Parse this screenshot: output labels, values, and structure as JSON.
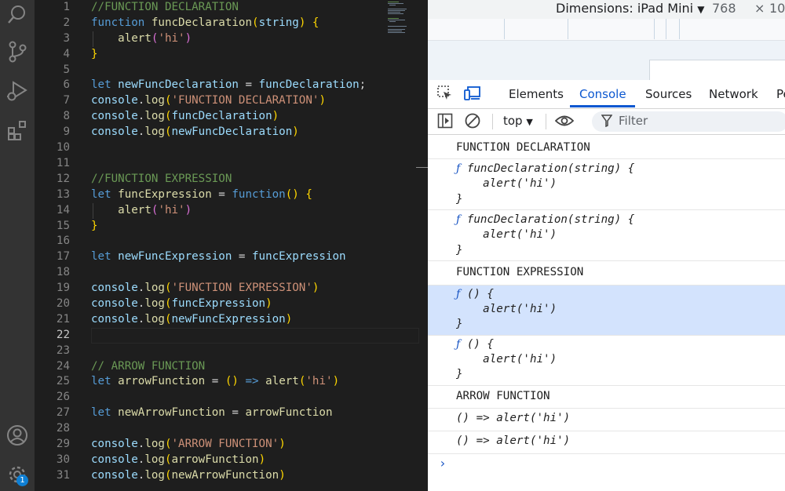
{
  "editor": {
    "active_line": "22",
    "line_numbers": [
      "1",
      "2",
      "3",
      "4",
      "5",
      "6",
      "7",
      "8",
      "9",
      "10",
      "11",
      "12",
      "13",
      "14",
      "15",
      "16",
      "17",
      "18",
      "19",
      "20",
      "21",
      "22",
      "23",
      "24",
      "25",
      "26",
      "27",
      "28",
      "29",
      "30",
      "31"
    ],
    "code": {
      "l1": "//FUNCTION DECLARATION",
      "l2_kw": "function",
      "l2_fn": "funcDeclaration",
      "l2_param": "string",
      "l3_fn": "alert",
      "l3_str": "'hi'",
      "l6_kw": "let",
      "l6_var": "newFuncDeclaration",
      "l6_rhs": "funcDeclaration",
      "l7_obj": "console",
      "l7_fn": "log",
      "l7_str": "'FUNCTION DECLARATION'",
      "l8_obj": "console",
      "l8_fn": "log",
      "l8_arg": "funcDeclaration",
      "l9_obj": "console",
      "l9_fn": "log",
      "l9_arg": "newFuncDeclaration",
      "l12": "//FUNCTION EXPRESSION",
      "l13_kw": "let",
      "l13_var": "funcExpression",
      "l13_kw2": "function",
      "l14_fn": "alert",
      "l14_str": "'hi'",
      "l17_kw": "let",
      "l17_var": "newFuncExpression",
      "l17_rhs": "funcExpression",
      "l19_obj": "console",
      "l19_fn": "log",
      "l19_str": "'FUNCTION EXPRESSION'",
      "l20_obj": "console",
      "l20_fn": "log",
      "l20_arg": "funcExpression",
      "l21_obj": "console",
      "l21_fn": "log",
      "l21_arg": "newFuncExpression",
      "l24": "// ARROW FUNCTION",
      "l25_kw": "let",
      "l25_var": "arrowFunction",
      "l25_arrow": "=>",
      "l25_fn": "alert",
      "l25_str": "'hi'",
      "l27_kw": "let",
      "l27_var": "newArrowFunction",
      "l27_rhs": "arrowFunction",
      "l29_obj": "console",
      "l29_fn": "log",
      "l29_str": "'ARROW FUNCTION'",
      "l30_obj": "console",
      "l30_fn": "log",
      "l30_arg": "arrowFunction",
      "l31_obj": "console",
      "l31_fn": "log",
      "l31_arg": "newArrowFunction"
    }
  },
  "activity_bar": {
    "icons": [
      "search-icon",
      "source-control-icon",
      "run-debug-icon",
      "extensions-icon",
      "account-icon",
      "settings-gear-icon"
    ],
    "settings_badge": "1"
  },
  "device_toolbar": {
    "dimensions_label": "Dimensions: iPad Mini",
    "width": "768",
    "times": "×",
    "height_partial": "10"
  },
  "devtools": {
    "tabs": [
      "Elements",
      "Console",
      "Sources",
      "Network",
      "Pe"
    ],
    "active_tab": "Console",
    "context": "top",
    "filter_placeholder": "Filter"
  },
  "console": {
    "m1": "FUNCTION DECLARATION",
    "m2_head": "funcDeclaration(string) {",
    "m2_body": "    alert('hi')",
    "m2_end": "}",
    "m3_head": "funcDeclaration(string) {",
    "m3_body": "    alert('hi')",
    "m3_end": "}",
    "m4": "FUNCTION EXPRESSION",
    "m5_head": "() {",
    "m5_body": "    alert('hi')",
    "m5_end": "}",
    "m6_head": "() {",
    "m6_body": "    alert('hi')",
    "m6_end": "}",
    "m7": "ARROW FUNCTION",
    "m8": "() => alert('hi')",
    "m9": "() => alert('hi')",
    "f_glyph": "ƒ",
    "prompt": "›"
  },
  "colors": {
    "editor_bg": "#1e1e1e",
    "activity_bg": "#333333",
    "keyword": "#569cd6",
    "function": "#dcdcaa",
    "variable": "#9cdcfe",
    "string": "#ce9178",
    "comment": "#6a9955",
    "devtools_accent": "#0b57d0",
    "selected_row": "#d3e3fd"
  }
}
